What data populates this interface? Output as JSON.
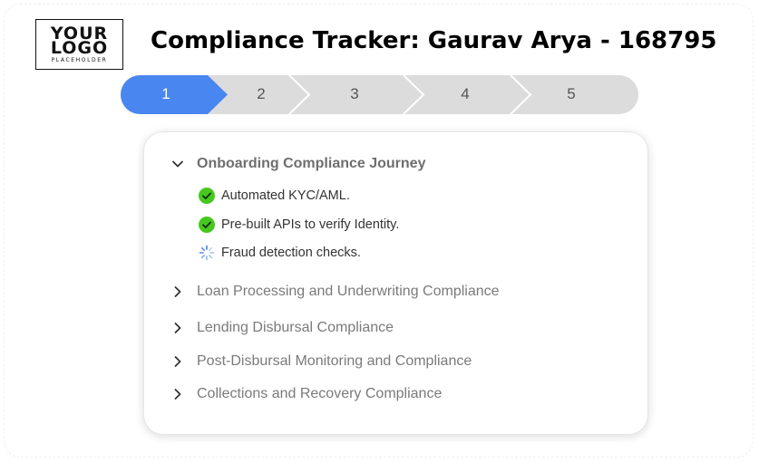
{
  "logo": {
    "line1": "YOUR",
    "line2": "LOGO",
    "sub": "PLACEHOLDER"
  },
  "header": {
    "title": "Compliance Tracker: Gaurav Arya - 168795"
  },
  "stepper": {
    "active_color": "#4A86F0",
    "inactive_color": "#DCDCDC",
    "steps": [
      "1",
      "2",
      "3",
      "4",
      "5"
    ],
    "active_step": "1"
  },
  "journey": {
    "open_section": {
      "title": "Onboarding Compliance Journey",
      "items": [
        {
          "label": "Automated KYC/AML.",
          "status": "done",
          "icon": "check-circle-icon"
        },
        {
          "label": "Pre-built APIs to verify Identity.",
          "status": "done",
          "icon": "check-circle-icon"
        },
        {
          "label": "Fraud detection checks.",
          "status": "in-progress",
          "icon": "spinner-icon"
        }
      ]
    },
    "collapsed_sections": [
      "Loan Processing and Underwriting Compliance",
      "Lending Disbursal Compliance",
      "Post-Disbursal Monitoring and Compliance",
      "Collections and Recovery Compliance"
    ]
  },
  "colors": {
    "success": "#47C81E",
    "spinner": "#4A86F0"
  }
}
